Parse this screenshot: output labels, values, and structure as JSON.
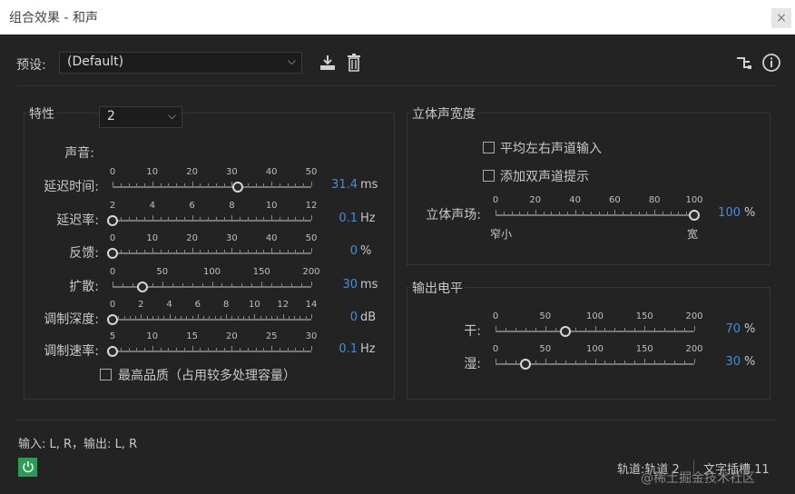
{
  "window": {
    "title": "组合效果 - 和声",
    "close_glyph": "×"
  },
  "preset": {
    "label": "预设:",
    "value": "(Default)"
  },
  "icons": {
    "save": "save-preset-icon",
    "delete": "trash-icon",
    "route": "routing-icon",
    "info": "info-icon"
  },
  "characteristics": {
    "title": "特性",
    "voice_label": "声音:",
    "voice_value": "2",
    "sliders": [
      {
        "label": "延迟时间:",
        "ticks": [
          "0",
          "10",
          "20",
          "30",
          "40",
          "50"
        ],
        "value_text": "31.4",
        "unit": "ms",
        "fraction": 0.628
      },
      {
        "label": "延迟率:",
        "ticks": [
          "2",
          "4",
          "6",
          "8",
          "10",
          "12"
        ],
        "value_text": "0.1",
        "unit": "Hz",
        "fraction": 0.0
      },
      {
        "label": "反馈:",
        "ticks": [
          "0",
          "10",
          "20",
          "30",
          "40",
          "50"
        ],
        "value_text": "0",
        "unit": "%",
        "fraction": 0.0
      },
      {
        "label": "扩散:",
        "ticks": [
          "0",
          "50",
          "100",
          "150",
          "200"
        ],
        "value_text": "30",
        "unit": "ms",
        "fraction": 0.15
      },
      {
        "label": "调制深度:",
        "ticks": [
          "0",
          "2",
          "4",
          "6",
          "8",
          "10",
          "12",
          "14"
        ],
        "value_text": "0",
        "unit": "dB",
        "fraction": 0.0
      },
      {
        "label": "调制速率:",
        "ticks": [
          "5",
          "10",
          "15",
          "20",
          "25",
          "30"
        ],
        "value_text": "0.1",
        "unit": "Hz",
        "fraction": 0.0
      }
    ],
    "best_quality_label": "最高品质（占用较多处理容量）"
  },
  "stereo_width": {
    "title": "立体声宽度",
    "avg_lr_label": "平均左右声道输入",
    "add_binaural_label": "添加双声道提示",
    "field_label": "立体声场:",
    "ticks": [
      "0",
      "20",
      "40",
      "60",
      "80",
      "100"
    ],
    "value_text": "100",
    "unit": "%",
    "fraction": 1.0,
    "min_label": "窄小",
    "max_label": "宽"
  },
  "output_level": {
    "title": "输出电平",
    "sliders": [
      {
        "label": "干:",
        "ticks": [
          "0",
          "50",
          "100",
          "150",
          "200"
        ],
        "value_text": "70",
        "unit": "%",
        "fraction": 0.35
      },
      {
        "label": "湿:",
        "ticks": [
          "0",
          "50",
          "100",
          "150",
          "200"
        ],
        "value_text": "30",
        "unit": "%",
        "fraction": 0.15
      }
    ]
  },
  "footer": {
    "io_text": "输入: L, R，输出: L, R",
    "track_text": "轨道:轨道 2",
    "slot_text": "文字插槽 11",
    "watermark": "@稀土掘金技术社区"
  },
  "colors": {
    "accent": "#3d8fe5",
    "background": "#232323",
    "power": "#2e9a5a"
  }
}
